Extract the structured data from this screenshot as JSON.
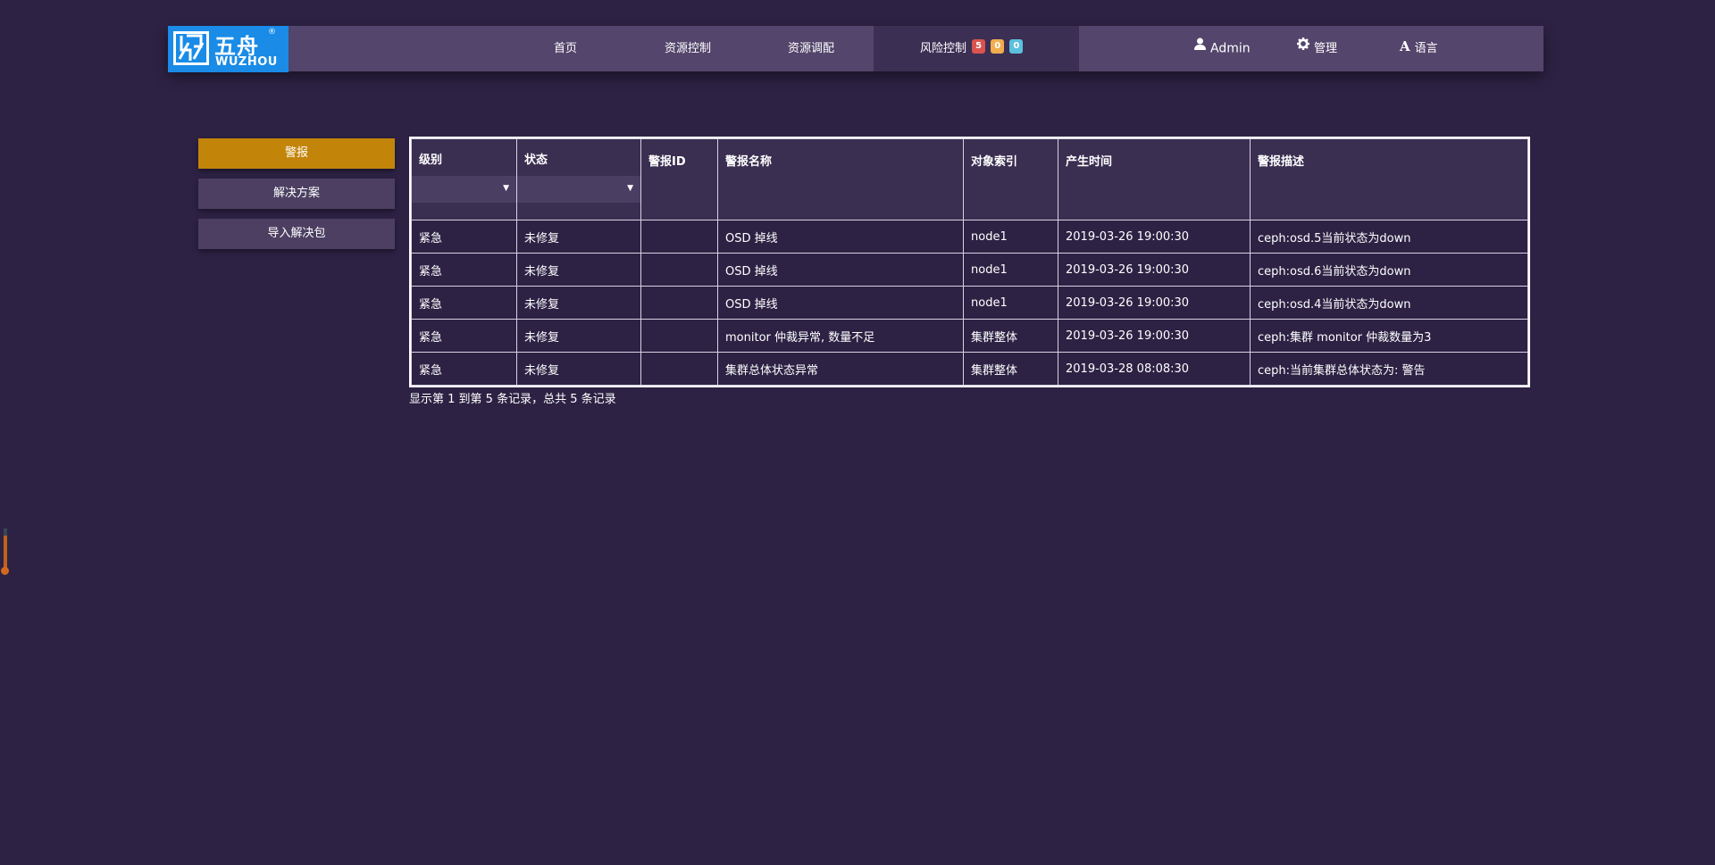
{
  "logo": {
    "cn": "五舟",
    "en": "WUZHOU",
    "reg": "®"
  },
  "nav": {
    "home": "首页",
    "resource_control": "资源控制",
    "resource_schedule": "资源调配",
    "risk_control": "风险控制",
    "badges": [
      {
        "value": "5",
        "color": "#d9534f"
      },
      {
        "value": "0",
        "color": "#f0ad4e"
      },
      {
        "value": "0",
        "color": "#5bc0de"
      }
    ],
    "user": "Admin",
    "manage": "管理",
    "language": "语言"
  },
  "sidebar": {
    "items": [
      {
        "label": "警报",
        "active": true
      },
      {
        "label": "解决方案",
        "active": false
      },
      {
        "label": "导入解决包",
        "active": false
      }
    ]
  },
  "table": {
    "headers": [
      "级别",
      "状态",
      "警报ID",
      "警报名称",
      "对象索引",
      "产生时间",
      "警报描述"
    ],
    "rows": [
      [
        "紧急",
        "未修复",
        "",
        "OSD 掉线",
        "node1",
        "2019-03-26 19:00:30",
        "ceph:osd.5当前状态为down"
      ],
      [
        "紧急",
        "未修复",
        "",
        "OSD 掉线",
        "node1",
        "2019-03-26 19:00:30",
        "ceph:osd.6当前状态为down"
      ],
      [
        "紧急",
        "未修复",
        "",
        "OSD 掉线",
        "node1",
        "2019-03-26 19:00:30",
        "ceph:osd.4当前状态为down"
      ],
      [
        "紧急",
        "未修复",
        "",
        "monitor 仲裁异常, 数量不足",
        "集群整体",
        "2019-03-26 19:00:30",
        "ceph:集群 monitor 仲裁数量为3"
      ],
      [
        "紧急",
        "未修复",
        "",
        "集群总体状态异常",
        "集群整体",
        "2019-03-28 08:08:30",
        "ceph:当前集群总体状态为: 警告"
      ]
    ]
  },
  "pagination_info": "显示第 1 到第 5 条记录，总共 5 条记录",
  "colors": {
    "background": "#2d2244",
    "navbar": "#53456b",
    "active_tab": "#3c2f54",
    "accent": "#c2850a",
    "logo_bg": "#1a8be6"
  }
}
